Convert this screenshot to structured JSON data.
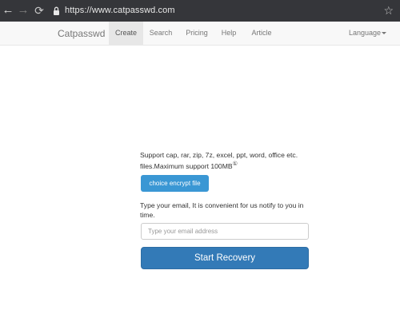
{
  "browser": {
    "url": "https://www.catpasswd.com",
    "back_icon": "←",
    "forward_icon": "→",
    "reload_icon": "⟳",
    "star_icon": "☆"
  },
  "navbar": {
    "brand": "Catpasswd",
    "items": [
      {
        "label": "Create",
        "active": true
      },
      {
        "label": "Search",
        "active": false
      },
      {
        "label": "Pricing",
        "active": false
      },
      {
        "label": "Help",
        "active": false
      },
      {
        "label": "Article",
        "active": false
      }
    ],
    "language": "Language"
  },
  "main": {
    "support_text": "Support cap, rar, zip, 7z, excel, ppt, word, office etc. files.Maximum support 100MB",
    "info_mark": "①",
    "choice_button": "choice encrypt file",
    "email_note": "Type your email, It is convenient for us notify to you in time.",
    "email_placeholder": "Type your email address",
    "recovery_button": "Start Recovery"
  },
  "colors": {
    "browser_bar": "#35363a",
    "navbar_bg": "#f8f8f8",
    "primary": "#337ab7",
    "info": "#3a97d4"
  }
}
